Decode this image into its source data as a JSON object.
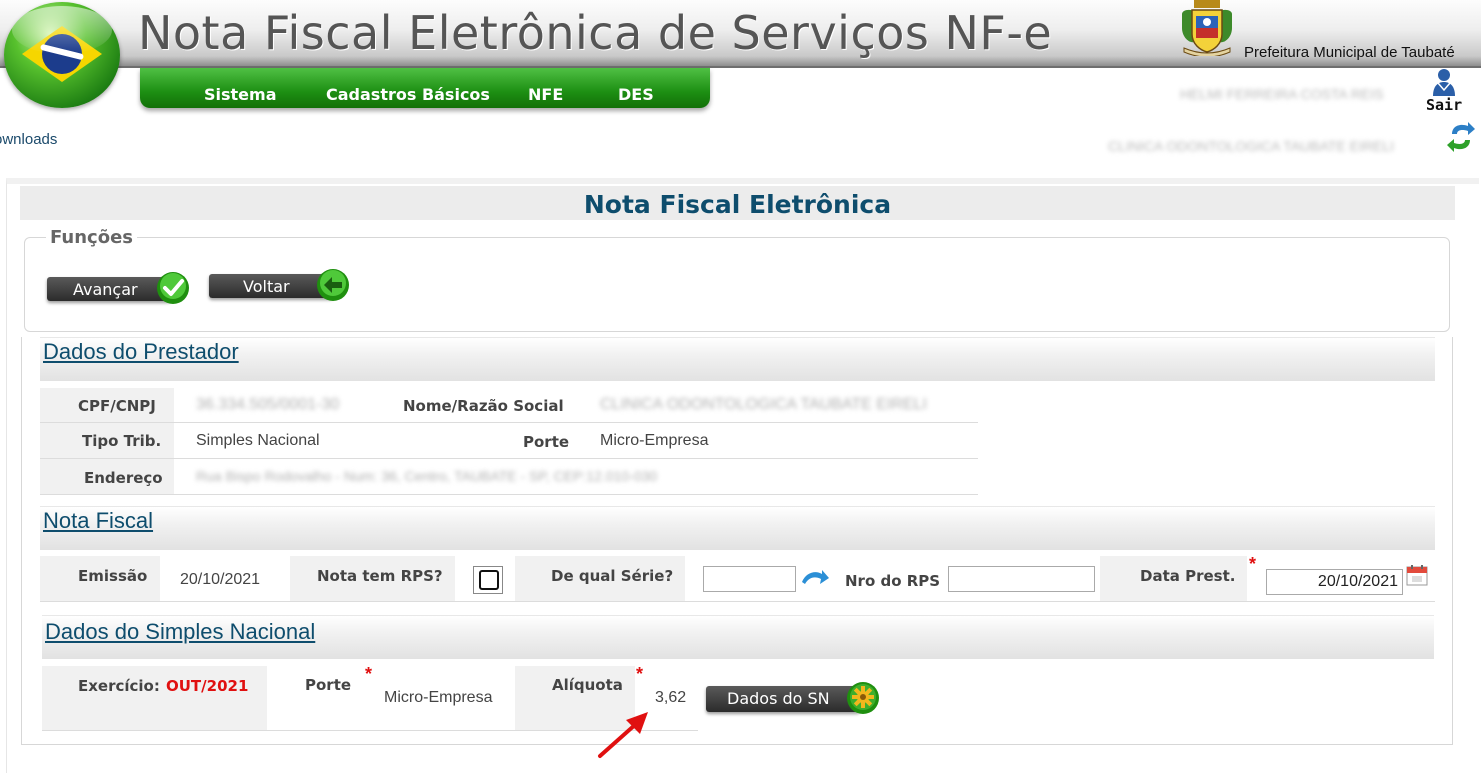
{
  "header": {
    "app_title": "Nota Fiscal Eletrônica de Serviços NF-e",
    "prefeitura": "Prefeitura Municipal de Taubaté",
    "user_name": "HELMI FERREIRA COSTA REIS",
    "company_name": "CLINICA ODONTOLOGICA TAUBATE EIRELI",
    "logout_label": "Sair",
    "downloads_label": "ownloads"
  },
  "menu": [
    {
      "label": "Sistema"
    },
    {
      "label": "Cadastros Básicos"
    },
    {
      "label": "NFE"
    },
    {
      "label": "DES"
    }
  ],
  "page": {
    "title": "Nota Fiscal Eletrônica"
  },
  "funcoes": {
    "legend": "Funções",
    "advance_label": "Avançar",
    "back_label": "Voltar"
  },
  "prestador": {
    "section_title": "Dados do Prestador",
    "cpf_label": "CPF/CNPJ",
    "cpf_value": "36.334.505/0001-30",
    "nome_label": "Nome/Razão Social",
    "nome_value": "CLINICA ODONTOLOGICA TAUBATE EIRELI",
    "tipo_label": "Tipo Trib.",
    "tipo_value": "Simples Nacional",
    "porte_label": "Porte",
    "porte_value": "Micro-Empresa",
    "endereco_label": "Endereço",
    "endereco_value": "Rua Bispo Rodovalho - Num: 36, Centro, TAUBATE - SP, CEP:12.010-030"
  },
  "nota": {
    "section_title": "Nota Fiscal",
    "emissao_label": "Emissão",
    "emissao_value": "20/10/2021",
    "rps_label": "Nota tem RPS?",
    "rps_checked": false,
    "serie_label": "De qual Série?",
    "serie_value": "",
    "nro_label": "Nro do RPS",
    "nro_value": "",
    "data_label": "Data Prest.",
    "data_value": "20/10/2021",
    "required_mark": "*"
  },
  "simples": {
    "section_title": "Dados do Simples Nacional",
    "exercicio_label": "Exercício:",
    "exercicio_value": "OUT/2021",
    "porte_label": "Porte",
    "porte_value": "Micro-Empresa",
    "aliquota_label": "Alíquota",
    "aliquota_value": "3,62",
    "dados_button": "Dados do SN",
    "required_mark": "*"
  },
  "colors": {
    "accent_green": "#1d8f13",
    "title_blue": "#0e4d6d",
    "required_red": "#e01010",
    "annotation_red": "#e01010"
  },
  "icons": [
    "brazil-globe-icon",
    "coat-of-arms-icon",
    "user-logout-icon",
    "switch-company-icon",
    "check-icon",
    "arrow-left-icon",
    "arrow-right-icon",
    "calendar-icon",
    "gear-icon",
    "annotation-arrow-icon"
  ]
}
